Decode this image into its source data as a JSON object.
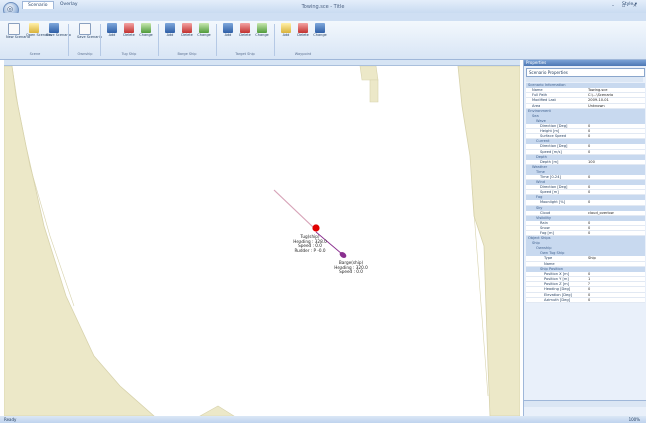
{
  "window": {
    "title": "Towing.sce - Title",
    "controls": "– ▫ ✕"
  },
  "tabs": [
    {
      "label": "Scenario"
    },
    {
      "label": "Overlay"
    }
  ],
  "style_menu": "Style ▾",
  "ribbon": {
    "groups": [
      {
        "label": "Scene",
        "buttons": [
          "New Scenario",
          "Open Scenario",
          "Save Scenario"
        ]
      },
      {
        "label": "Ownship",
        "buttons": [
          "Save Scenario"
        ]
      },
      {
        "label": "Tug Ship",
        "buttons": [
          "Add",
          "Delete",
          "Change"
        ]
      },
      {
        "label": "Barge Ship",
        "buttons": [
          "Add",
          "Delete",
          "Change"
        ]
      },
      {
        "label": "Target Ship",
        "buttons": [
          "Add",
          "Delete",
          "Change"
        ]
      },
      {
        "label": "Waypoint",
        "buttons": [
          "Add",
          "Delete",
          "Change"
        ]
      }
    ]
  },
  "map": {
    "tug": {
      "name": "Tug(ship)",
      "heading": "Heading : 328.0",
      "speed": "Speed : 0.0",
      "rudder": "Rudder : P -0.0"
    },
    "barge": {
      "name": "Barge(ship)",
      "heading": "Heading : 320.0",
      "speed": "Speed : 0.0"
    }
  },
  "properties": {
    "header": "Properties",
    "combo": "Scenario Properties",
    "rows": [
      {
        "type": "cat",
        "k": "Scenario Information",
        "i": 0
      },
      {
        "type": "val",
        "k": "Name",
        "v": "Towing.sce",
        "i": 1
      },
      {
        "type": "val",
        "k": "Full Path",
        "v": "C:\\...\\Scenario",
        "i": 1
      },
      {
        "type": "val",
        "k": "Modified Last",
        "v": "2009-10-01",
        "i": 1
      },
      {
        "type": "val",
        "k": "Area",
        "v": "Unknown",
        "i": 1
      },
      {
        "type": "cat",
        "k": "Environment",
        "i": 0
      },
      {
        "type": "cat",
        "k": "Sea",
        "i": 1
      },
      {
        "type": "cat",
        "k": "Wave",
        "i": 2
      },
      {
        "type": "val",
        "k": "Direction [Deg]",
        "v": "0",
        "i": 3
      },
      {
        "type": "val",
        "k": "Height [m]",
        "v": "0",
        "i": 3
      },
      {
        "type": "val",
        "k": "Surface Speed",
        "v": "0",
        "i": 3
      },
      {
        "type": "cat",
        "k": "Current",
        "i": 2
      },
      {
        "type": "val",
        "k": "Direction [Deg]",
        "v": "0",
        "i": 3
      },
      {
        "type": "val",
        "k": "Speed [m/s]",
        "v": "0",
        "i": 3
      },
      {
        "type": "cat",
        "k": "Depth",
        "i": 2
      },
      {
        "type": "val",
        "k": "Depth [m]",
        "v": "100",
        "i": 3
      },
      {
        "type": "cat",
        "k": "Weather",
        "i": 1
      },
      {
        "type": "cat",
        "k": "Time",
        "i": 2
      },
      {
        "type": "val",
        "k": "Time [0-24]",
        "v": "0",
        "i": 3
      },
      {
        "type": "cat",
        "k": "Wind",
        "i": 2
      },
      {
        "type": "val",
        "k": "Direction [Deg]",
        "v": "0",
        "i": 3
      },
      {
        "type": "val",
        "k": "Speed [m]",
        "v": "0",
        "i": 3
      },
      {
        "type": "cat",
        "k": "Fog",
        "i": 2
      },
      {
        "type": "val",
        "k": "Moonlight [%]",
        "v": "0",
        "i": 3
      },
      {
        "type": "cat",
        "k": "Sky",
        "i": 2
      },
      {
        "type": "val",
        "k": "Cloud",
        "v": "cloud_overlow",
        "i": 3
      },
      {
        "type": "cat",
        "k": "Visibility",
        "i": 2
      },
      {
        "type": "val",
        "k": "Rain",
        "v": "0",
        "i": 3
      },
      {
        "type": "val",
        "k": "Snow",
        "v": "0",
        "i": 3
      },
      {
        "type": "val",
        "k": "Fog [m]",
        "v": "0",
        "i": 3
      },
      {
        "type": "cat",
        "k": "Object Ships",
        "i": 0
      },
      {
        "type": "cat",
        "k": "Ship",
        "i": 1
      },
      {
        "type": "cat",
        "k": "Ownship",
        "i": 2
      },
      {
        "type": "cat",
        "k": "Own Tug Ship",
        "i": 3
      },
      {
        "type": "val",
        "k": "Type",
        "v": "Ship",
        "i": 4
      },
      {
        "type": "val",
        "k": "Name",
        "v": "",
        "i": 4
      },
      {
        "type": "cat",
        "k": "Ship Position",
        "i": 3
      },
      {
        "type": "val",
        "k": "Position X [m]",
        "v": "0",
        "i": 4
      },
      {
        "type": "val",
        "k": "Position Y [m]",
        "v": "1",
        "i": 4
      },
      {
        "type": "val",
        "k": "Position Z [m]",
        "v": "?",
        "i": 4
      },
      {
        "type": "val",
        "k": "Heading [Deg]",
        "v": "0",
        "i": 4
      },
      {
        "type": "val",
        "k": "Elevation [Deg]",
        "v": "0",
        "i": 4
      },
      {
        "type": "val",
        "k": "Azimuth [Deg]",
        "v": "0",
        "i": 4
      }
    ]
  },
  "statusbar": {
    "text": "Ready",
    "right": "100%"
  },
  "colors": {
    "land": "#ece8c8",
    "land_edge": "#d8d3ad",
    "tug": "#e00000",
    "barge": "#8a2f8f",
    "track": "#d7a3b8"
  }
}
